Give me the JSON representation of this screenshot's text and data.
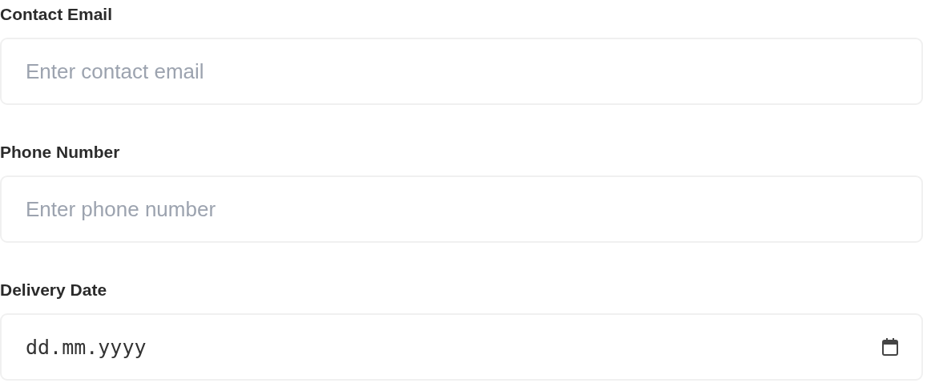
{
  "fields": [
    {
      "kind": "text",
      "label": "Contact Email",
      "placeholder": "Enter contact email"
    },
    {
      "kind": "text",
      "label": "Phone Number",
      "placeholder": "Enter phone number"
    },
    {
      "kind": "date",
      "label": "Delivery Date",
      "value": "dd.mm.yyyy"
    }
  ]
}
